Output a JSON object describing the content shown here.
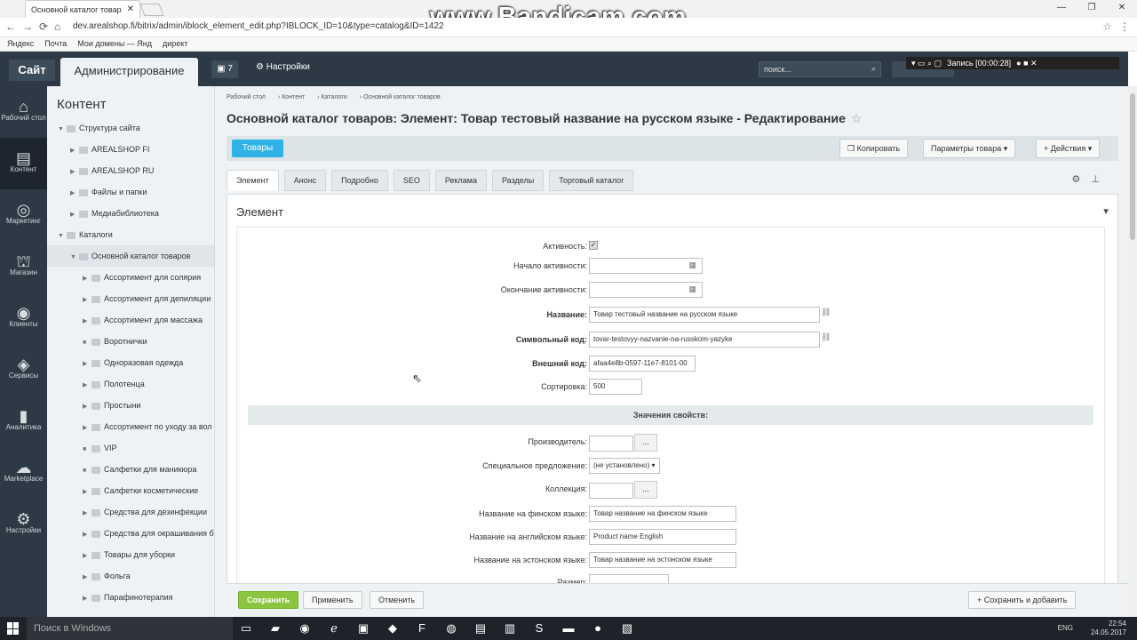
{
  "browser": {
    "tab_title": "Основной каталог товар",
    "url": "dev.arealshop.fi/bitrix/admin/iblock_element_edit.php?IBLOCK_ID=10&type=catalog&ID=1422",
    "bookmarks": [
      "Яндекс",
      "Почта",
      "Мои домены — Янд",
      "директ"
    ]
  },
  "watermark": "www.Bandicam.com",
  "recording": {
    "label": "Запись [00:00:28]"
  },
  "admin_header": {
    "site_label": "Сайт",
    "admin_label": "Администрирование",
    "notifications_count": "7",
    "settings_label": "Настройки",
    "search_placeholder": "поиск..."
  },
  "iconbar": [
    {
      "label": "Рабочий стол",
      "icon": "home-icon",
      "glyph": "⌂"
    },
    {
      "label": "Контент",
      "icon": "document-icon",
      "glyph": "▤"
    },
    {
      "label": "Маркетинг",
      "icon": "target-icon",
      "glyph": "◎"
    },
    {
      "label": "Магазин",
      "icon": "basket-icon",
      "glyph": "⛫"
    },
    {
      "label": "Клиенты",
      "icon": "clients-icon",
      "glyph": "◉"
    },
    {
      "label": "Сервисы",
      "icon": "layers-icon",
      "glyph": "◈"
    },
    {
      "label": "Аналитика",
      "icon": "chart-icon",
      "glyph": "▮"
    },
    {
      "label": "Marketplace",
      "icon": "cloud-icon",
      "glyph": "☁"
    },
    {
      "label": "Настройки",
      "icon": "gear-icon",
      "glyph": "⚙"
    }
  ],
  "left_menu": {
    "title": "Контент",
    "items": [
      {
        "label": "Структура сайта",
        "level": 0,
        "arrow": "▼"
      },
      {
        "label": "AREALSHOP FI",
        "level": 1,
        "arrow": "▶"
      },
      {
        "label": "AREALSHOP RU",
        "level": 1,
        "arrow": "▶"
      },
      {
        "label": "Файлы и папки",
        "level": 1,
        "arrow": "▶"
      },
      {
        "label": "Медиабиблиотека",
        "level": 1,
        "arrow": "▶"
      },
      {
        "label": "Каталоги",
        "level": 0,
        "arrow": "▼"
      },
      {
        "label": "Основной каталог товаров",
        "level": 1,
        "arrow": "▼"
      },
      {
        "label": "Ассортимент для солярия",
        "level": 2,
        "arrow": "▶"
      },
      {
        "label": "Ассортимент для депиляции",
        "level": 2,
        "arrow": "▶"
      },
      {
        "label": "Ассортимент для массажа",
        "level": 2,
        "arrow": "▶"
      },
      {
        "label": "Воротнички",
        "level": 2,
        "arrow": "■"
      },
      {
        "label": "Одноразовая одежда",
        "level": 2,
        "arrow": "▶"
      },
      {
        "label": "Полотенца",
        "level": 2,
        "arrow": "▶"
      },
      {
        "label": "Простыни",
        "level": 2,
        "arrow": "▶"
      },
      {
        "label": "Ассортимент по уходу за вол",
        "level": 2,
        "arrow": "▶"
      },
      {
        "label": "VIP",
        "level": 2,
        "arrow": "■"
      },
      {
        "label": "Салфетки для маникюра",
        "level": 2,
        "arrow": "■"
      },
      {
        "label": "Салфетки косметические",
        "level": 2,
        "arrow": "▶"
      },
      {
        "label": "Средства для дезинфекции",
        "level": 2,
        "arrow": "▶"
      },
      {
        "label": "Средства для окрашивания бр",
        "level": 2,
        "arrow": "▶"
      },
      {
        "label": "Товары для уборки",
        "level": 2,
        "arrow": "▶"
      },
      {
        "label": "Фольга",
        "level": 2,
        "arrow": "▶"
      },
      {
        "label": "Парафинотерапия",
        "level": 2,
        "arrow": "▶"
      }
    ]
  },
  "breadcrumb": [
    "Рабочий стол",
    "Контент",
    "Каталоги",
    "Основной каталог товаров"
  ],
  "page_title": "Основной каталог товаров: Элемент: Товар тестовый название на русском языке - Редактирование",
  "toolbar": {
    "goods_label": "Товары",
    "copy_label": "Копировать",
    "params_label": "Параметры товара",
    "actions_label": "Действия"
  },
  "tabs": [
    "Элемент",
    "Анонс",
    "Подробно",
    "SEO",
    "Реклама",
    "Разделы",
    "Торговый каталог"
  ],
  "form": {
    "section_title": "Элемент",
    "active_label": "Активность:",
    "start_label": "Начало активности:",
    "end_label": "Окончание активности:",
    "name_label": "Название:",
    "name_value": "Товар тестовый название на русском языке",
    "code_label": "Символьный код:",
    "code_value": "tovar-testovyy-nazvanie-na-russkom-yazyke",
    "xml_label": "Внешний код:",
    "xml_value": "afaa4e8b-0597-11e7-8101-00",
    "sort_label": "Сортировка:",
    "sort_value": "500",
    "props_header": "Значения свойств:",
    "maker_label": "Производитель:",
    "special_label": "Специальное предложение:",
    "special_value": "(не установлено)",
    "collection_label": "Коллекция:",
    "fi_label": "Название на финском языке:",
    "fi_value": "Товар название на финском языке",
    "en_label": "Название на английском языке:",
    "en_value": "Product name English",
    "et_label": "Название на эстонском языке:",
    "et_value": "Товар название на эстонском языке",
    "size_label": "Размер:"
  },
  "bottom": {
    "save": "Сохранить",
    "apply": "Применить",
    "cancel": "Отменить",
    "save_add": "Сохранить и добавить"
  },
  "taskbar": {
    "search_placeholder": "Поиск в Windows",
    "lang": "ENG",
    "time": "22:54",
    "date": "24.05.2017"
  }
}
